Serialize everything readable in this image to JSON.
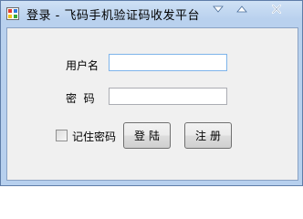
{
  "window": {
    "title": "登录 - 飞码手机验证码收发平台",
    "controls": {
      "minimize_icon": "minimize-icon",
      "maximize_icon": "maximize-icon",
      "close_icon": "close-icon"
    }
  },
  "form": {
    "username_label": "用户名",
    "username_value": "",
    "password_label": "密  码",
    "password_value": "",
    "remember_label": "记住密码",
    "remember_checked": false,
    "login_label": "登陆",
    "register_label": "注册"
  },
  "colors": {
    "titlebar": "#b9d1ee",
    "client_bg": "#f0f0f0",
    "focus_border": "#7eb4ea"
  }
}
